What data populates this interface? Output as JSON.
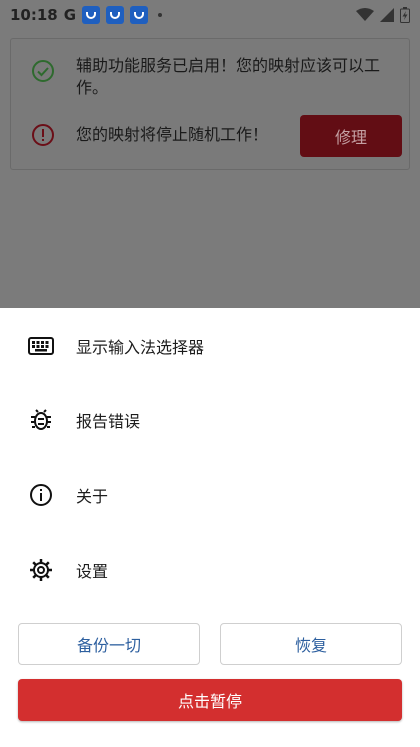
{
  "status_bar": {
    "time": "10:18",
    "google_letter": "G",
    "icons": [
      "app-icon",
      "app-icon",
      "app-icon",
      "notification-dot",
      "wifi-icon",
      "signal-icon",
      "battery-icon"
    ]
  },
  "card": {
    "service_message": "辅助功能服务已启用！您的映射应该可以工作。",
    "warning_message": "您的映射将停止随机工作！",
    "fix_button": "修理",
    "colors": {
      "success": "#2e7d32",
      "error": "#b71c1c",
      "fix_button_bg": "#620d14"
    }
  },
  "sheet": {
    "items": [
      {
        "label": "显示输入法选择器",
        "icon": "keyboard-icon"
      },
      {
        "label": "报告错误",
        "icon": "bug-icon"
      },
      {
        "label": "关于",
        "icon": "info-icon"
      },
      {
        "label": "设置",
        "icon": "gear-icon"
      }
    ],
    "backup_button": "备份一切",
    "restore_button": "恢复",
    "pause_button": "点击暂停",
    "colors": {
      "accent": "#2d5f9f",
      "pause_bg": "#d32f2f"
    }
  }
}
